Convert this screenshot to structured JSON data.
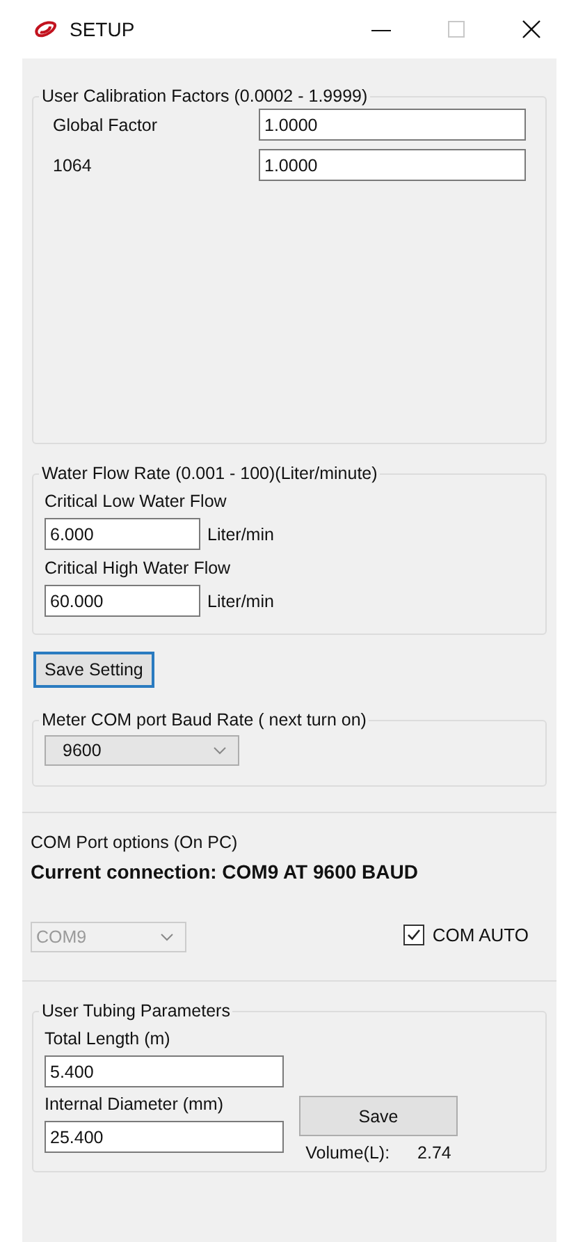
{
  "window": {
    "title": "SETUP"
  },
  "calibration": {
    "title": "User Calibration Factors (0.0002 - 1.9999)",
    "fields": [
      {
        "label": "Global Factor",
        "value": "1.0000"
      },
      {
        "label": "1064",
        "value": "1.0000"
      }
    ]
  },
  "water_flow": {
    "title": "Water Flow  Rate (0.001 -  100)(Liter/minute)",
    "fields": [
      {
        "label": "Critical Low Water Flow",
        "value": "6.000",
        "unit": "Liter/min"
      },
      {
        "label": "Critical High Water Flow",
        "value": "60.000",
        "unit": "Liter/min"
      }
    ]
  },
  "save_setting_button": "Save Setting",
  "baud": {
    "title": "Meter COM port Baud Rate ( next turn on)",
    "value": "9600"
  },
  "com_port": {
    "title": "COM Port  options (On PC)",
    "connection": "Current connection: COM9 AT 9600 BAUD",
    "port": {
      "value": "COM9",
      "disabled": true
    },
    "auto": {
      "label": "COM AUTO",
      "checked": true
    }
  },
  "tubing": {
    "title": "User Tubing Parameters",
    "length": {
      "label": "Total Length (m)",
      "value": "5.400"
    },
    "diameter": {
      "label": "Internal Diameter (mm)",
      "value": "25.400"
    },
    "save_button": "Save",
    "volume_label": "Volume(L):",
    "volume_value": "2.74"
  }
}
